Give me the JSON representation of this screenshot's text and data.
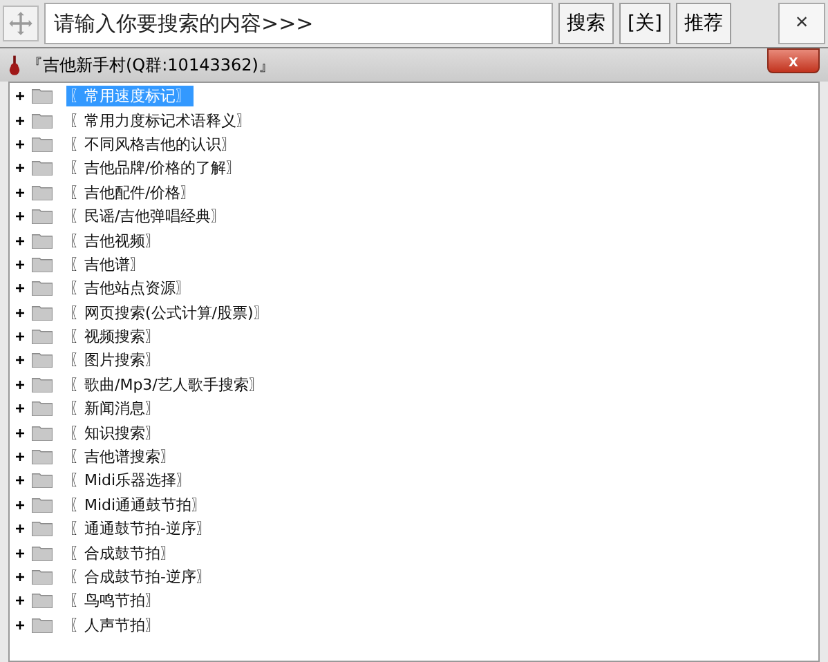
{
  "toolbar": {
    "search": {
      "placeholder": "请输入你要搜索的内容>>>"
    },
    "buttons": [
      "搜索",
      "[关]",
      "推荐"
    ],
    "close": "×"
  },
  "window": {
    "title": "『吉他新手村(Q群:10143362)』",
    "close": "x"
  },
  "tree": {
    "items": [
      {
        "label": "〖常用速度标记〗",
        "expanded": false,
        "selected": true
      },
      {
        "label": "〖常用力度标记术语释义〗",
        "expanded": false,
        "selected": false
      },
      {
        "label": "〖不同风格吉他的认识〗",
        "expanded": false,
        "selected": false
      },
      {
        "label": "〖吉他品牌/价格的了解〗",
        "expanded": false,
        "selected": false
      },
      {
        "label": "〖吉他配件/价格〗",
        "expanded": false,
        "selected": false
      },
      {
        "label": "〖民谣/吉他弹唱经典〗",
        "expanded": false,
        "selected": false
      },
      {
        "label": "〖吉他视频〗",
        "expanded": false,
        "selected": false
      },
      {
        "label": "〖吉他谱〗",
        "expanded": false,
        "selected": false
      },
      {
        "label": "〖吉他站点资源〗",
        "expanded": false,
        "selected": false
      },
      {
        "label": "〖网页搜索(公式计算/股票)〗",
        "expanded": false,
        "selected": false
      },
      {
        "label": "〖视频搜索〗",
        "expanded": false,
        "selected": false
      },
      {
        "label": "〖图片搜索〗",
        "expanded": false,
        "selected": false
      },
      {
        "label": "〖歌曲/Mp3/艺人歌手搜索〗",
        "expanded": false,
        "selected": false
      },
      {
        "label": "〖新闻消息〗",
        "expanded": false,
        "selected": false
      },
      {
        "label": "〖知识搜索〗",
        "expanded": false,
        "selected": false
      },
      {
        "label": "〖吉他谱搜索〗",
        "expanded": false,
        "selected": false
      },
      {
        "label": "〖Midi乐器选择〗",
        "expanded": false,
        "selected": false
      },
      {
        "label": "〖Midi通通鼓节拍〗",
        "expanded": false,
        "selected": false
      },
      {
        "label": "〖通通鼓节拍-逆序〗",
        "expanded": false,
        "selected": false
      },
      {
        "label": "〖合成鼓节拍〗",
        "expanded": false,
        "selected": false
      },
      {
        "label": "〖合成鼓节拍-逆序〗",
        "expanded": false,
        "selected": false
      },
      {
        "label": "〖鸟鸣节拍〗",
        "expanded": false,
        "selected": false
      },
      {
        "label": "〖人声节拍〗",
        "expanded": false,
        "selected": false
      }
    ]
  }
}
